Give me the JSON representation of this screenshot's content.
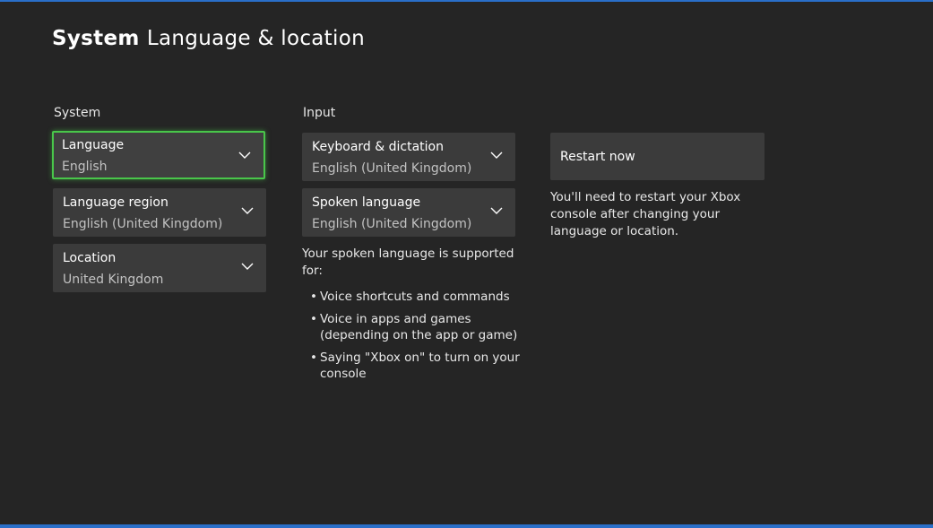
{
  "header": {
    "title_bold": "System",
    "title_rest": "Language & location"
  },
  "system": {
    "heading": "System",
    "language": {
      "label": "Language",
      "value": "English"
    },
    "language_region": {
      "label": "Language region",
      "value": "English (United Kingdom)"
    },
    "location": {
      "label": "Location",
      "value": "United Kingdom"
    }
  },
  "input": {
    "heading": "Input",
    "keyboard": {
      "label": "Keyboard & dictation",
      "value": "English (United Kingdom)"
    },
    "spoken_language": {
      "label": "Spoken language",
      "value": "English (United Kingdom)"
    },
    "support_intro": "Your spoken language is supported for:",
    "support_items": [
      "Voice shortcuts and commands",
      "Voice in apps and games (depending on the app or game)",
      "Saying \"Xbox on\" to turn on your console"
    ]
  },
  "restart": {
    "button_label": "Restart now",
    "note": "You'll need to restart your Xbox console after changing your language or location."
  },
  "icons": {
    "dropdown": "chevron-down-icon",
    "bullet": "bullet"
  },
  "colors": {
    "background": "#252525",
    "card": "#3b3b3b",
    "focus": "#49c64a",
    "edge": "#2a6fc9"
  }
}
